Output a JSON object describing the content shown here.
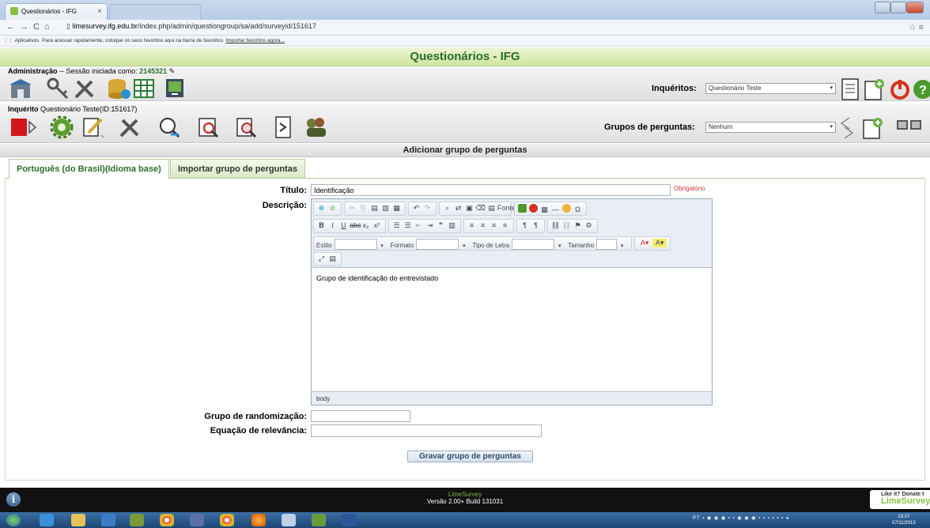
{
  "browser": {
    "tab_title": "Questionários - IFG",
    "tab_close": "×",
    "url_host": "limesurvey.ifg.edu.br",
    "url_path": "/index.php/admin/questiongroup/sa/add/surveyid/151617",
    "bookmarks_apps": "Aplicativos",
    "bookmarks_hint": "Para acessar rapidamente, coloque os seus favoritos aqui na barra de favoritos.",
    "bookmarks_import": "Importar favoritos agora..."
  },
  "header": {
    "title": "Questionários - IFG",
    "admin_label": "Administração",
    "session_text": "-- Sessão iniciada como:",
    "session_user": "2145321",
    "surveys_label": "Inquéritos:",
    "surveys_value": "Questionário Teste",
    "survey_label": "Inquérito",
    "survey_name": "Questionário Teste(ID:151617)",
    "groups_label": "Grupos de perguntas:",
    "groups_value": "Nenhum"
  },
  "section": {
    "title": "Adicionar grupo de perguntas",
    "tabs": [
      {
        "label": "Português (do Brasil)(Idioma base)"
      },
      {
        "label": "Importar grupo de perguntas"
      }
    ]
  },
  "form": {
    "title_label": "Título:",
    "title_value": "Identificação",
    "required_note": "Obrigatório",
    "description_label": "Descrição:",
    "description_value": "Grupo de identificação do entrevistado",
    "editor_path": "body",
    "editor_source_label": "Fonte",
    "editor_style_label": "Estilo",
    "editor_format_label": "Formato",
    "editor_font_label": "Tipo de Letra",
    "editor_size_label": "Tamanho",
    "randomization_label": "Grupo de randomização:",
    "randomization_value": "",
    "relevance_label": "Equação de relevância:",
    "relevance_value": "",
    "save_label": "Gravar grupo de perguntas"
  },
  "footer": {
    "brand": "LimeSurvey",
    "version": "Versão 2.00+ Build 131031",
    "donate_top": "Like it? Donate t",
    "donate_brand": "LimeSurvey"
  },
  "taskbar": {
    "lang": "PT",
    "time": "18:37",
    "date": "07/11/2013"
  },
  "colors": {
    "brand_green": "#2b6d2a",
    "required_red": "#d1353b",
    "footer_bg": "#111111"
  }
}
